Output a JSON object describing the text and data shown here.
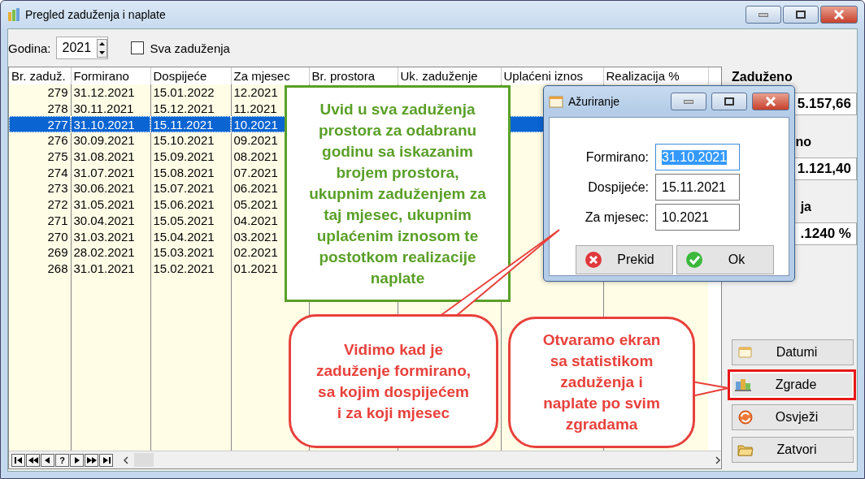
{
  "window": {
    "title": "Pregled zaduženja i naplate"
  },
  "filter": {
    "year_label": "Godina:",
    "year": "2021",
    "all_label": "Sva zaduženja",
    "all_checked": false
  },
  "table": {
    "columns": [
      "Br. zaduž.",
      "Formirano",
      "Dospijeće",
      "Za mjesec",
      "Br. prostora",
      "Uk. zaduženje",
      "Uplaćeni iznos",
      "Realizacija %"
    ],
    "rows": [
      {
        "cells": [
          "279",
          "31.12.2021",
          "15.01.2022",
          "12.2021"
        ],
        "selected": false
      },
      {
        "cells": [
          "278",
          "30.11.2021",
          "15.12.2021",
          "11.2021"
        ],
        "selected": false
      },
      {
        "cells": [
          "277",
          "31.10.2021",
          "15.11.2021",
          "10.2021"
        ],
        "selected": true
      },
      {
        "cells": [
          "276",
          "30.09.2021",
          "15.10.2021",
          "09.2021"
        ],
        "selected": false
      },
      {
        "cells": [
          "275",
          "31.08.2021",
          "15.09.2021",
          "08.2021"
        ],
        "selected": false
      },
      {
        "cells": [
          "274",
          "31.07.2021",
          "15.08.2021",
          "07.2021"
        ],
        "selected": false
      },
      {
        "cells": [
          "273",
          "30.06.2021",
          "15.07.2021",
          "06.2021"
        ],
        "selected": false
      },
      {
        "cells": [
          "272",
          "31.05.2021",
          "15.06.2021",
          "05.2021"
        ],
        "selected": false
      },
      {
        "cells": [
          "271",
          "30.04.2021",
          "15.05.2021",
          "04.2021"
        ],
        "selected": false
      },
      {
        "cells": [
          "270",
          "31.03.2021",
          "15.04.2021",
          "03.2021"
        ],
        "selected": false
      },
      {
        "cells": [
          "269",
          "28.02.2021",
          "15.03.2021",
          "02.2021"
        ],
        "selected": false
      },
      {
        "cells": [
          "268",
          "31.01.2021",
          "15.02.2021",
          "01.2021"
        ],
        "selected": false
      }
    ]
  },
  "navigator": [
    {
      "kind": "first"
    },
    {
      "kind": "prev-page"
    },
    {
      "kind": "prev"
    },
    {
      "kind": "help",
      "label": "?"
    },
    {
      "kind": "next"
    },
    {
      "kind": "next-page"
    },
    {
      "kind": "last"
    }
  ],
  "summary": [
    {
      "label": "Zaduženo",
      "value": "5.157,66"
    },
    {
      "label": "no",
      "value": "1.121,40"
    },
    {
      "label": "ja",
      "value": ".1240 %"
    }
  ],
  "buttons": [
    {
      "label": "Datumi",
      "kind": "calendar",
      "highlighted": false
    },
    {
      "label": "Zgrade",
      "kind": "buildings",
      "highlighted": true
    },
    {
      "label": "Osvježi",
      "kind": "refresh",
      "highlighted": false
    },
    {
      "label": "Zatvori",
      "kind": "folder",
      "highlighted": false
    }
  ],
  "dialog": {
    "title": "Ažuriranje",
    "fields": [
      {
        "label": "Formirano:",
        "value": "31.10.2021",
        "selected": true
      },
      {
        "label": "Dospijeće:",
        "value": "15.11.2021",
        "selected": false
      },
      {
        "label": "Za mjesec:",
        "value": "10.2021",
        "selected": false
      }
    ],
    "buttons": [
      {
        "label": "Prekid",
        "kind": "cancel"
      },
      {
        "label": "Ok",
        "kind": "ok"
      }
    ]
  },
  "callouts": [
    {
      "kind": "note",
      "color": "#5a9f28",
      "text": "Uvid u sva zaduženja prostora za odabranu godinu sa iskazanim brojem prostora, ukupnim zaduženjem za taj mjesec, ukupnim uplaćenim iznosom te postotkom realizacije naplate"
    },
    {
      "kind": "bubble",
      "color": "#e8413c",
      "text": "Vidimo kad je zaduženje formirano, sa kojim dospijećem i za koji mjesec"
    },
    {
      "kind": "bubble",
      "color": "#e8413c",
      "text": "Otvaramo ekran sa statistikom zaduženja i naplate po svim zgradama"
    }
  ]
}
